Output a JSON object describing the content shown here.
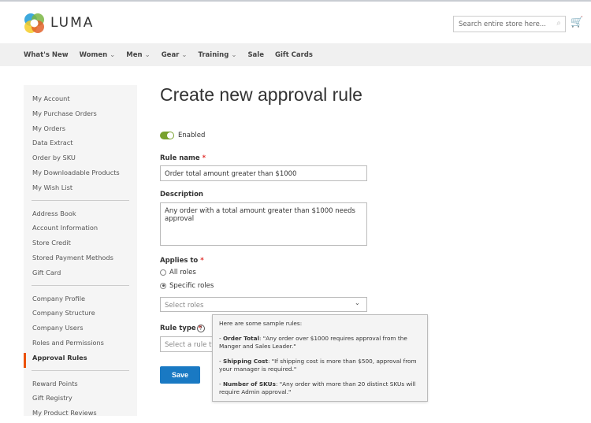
{
  "header": {
    "brand": "LUMA",
    "search_placeholder": "Search entire store here...",
    "colors": {
      "accent": "#eb5202",
      "primary": "#1979c3"
    }
  },
  "nav": {
    "items": [
      "What's New",
      "Women",
      "Men",
      "Gear",
      "Training",
      "Sale",
      "Gift Cards"
    ]
  },
  "sidebar": {
    "groups": [
      [
        "My Account",
        "My Purchase Orders",
        "My Orders",
        "Data Extract",
        "Order by SKU",
        "My Downloadable Products",
        "My Wish List"
      ],
      [
        "Address Book",
        "Account Information",
        "Store Credit",
        "Stored Payment Methods",
        "Gift Card"
      ],
      [
        "Company Profile",
        "Company Structure",
        "Company Users",
        "Roles and Permissions",
        "Approval Rules"
      ],
      [
        "Reward Points",
        "Gift Registry",
        "My Product Reviews"
      ]
    ],
    "active": "Approval Rules"
  },
  "main": {
    "title": "Create new approval rule",
    "enabled_label": "Enabled",
    "rule_name_label": "Rule name",
    "rule_name_value": "Order total  amount greater than $1000",
    "description_label": "Description",
    "description_value": "Any order with a total amount greater than $1000 needs approval",
    "applies_label": "Applies to",
    "all_roles": "All roles",
    "specific_roles": "Specific roles",
    "select_roles_placeholder": "Select roles",
    "rule_type_label": "Rule type",
    "rule_type_placeholder": "Select a rule type",
    "save": "Save",
    "required": "*",
    "help": "?"
  },
  "tooltip": {
    "intro": "Here are some sample rules:",
    "rules": [
      {
        "name": "Order Total",
        "text": ": \"Any order over $1000 requires approval from the Manger and Sales Leader.\""
      },
      {
        "name": "Shipping Cost",
        "text": ": \"If shipping cost is more than $500, approval from your manager is required.\""
      },
      {
        "name": "Number of SKUs",
        "text": ": \"Any order with more than 20 distinct SKUs will require Admin approval.\""
      }
    ]
  }
}
